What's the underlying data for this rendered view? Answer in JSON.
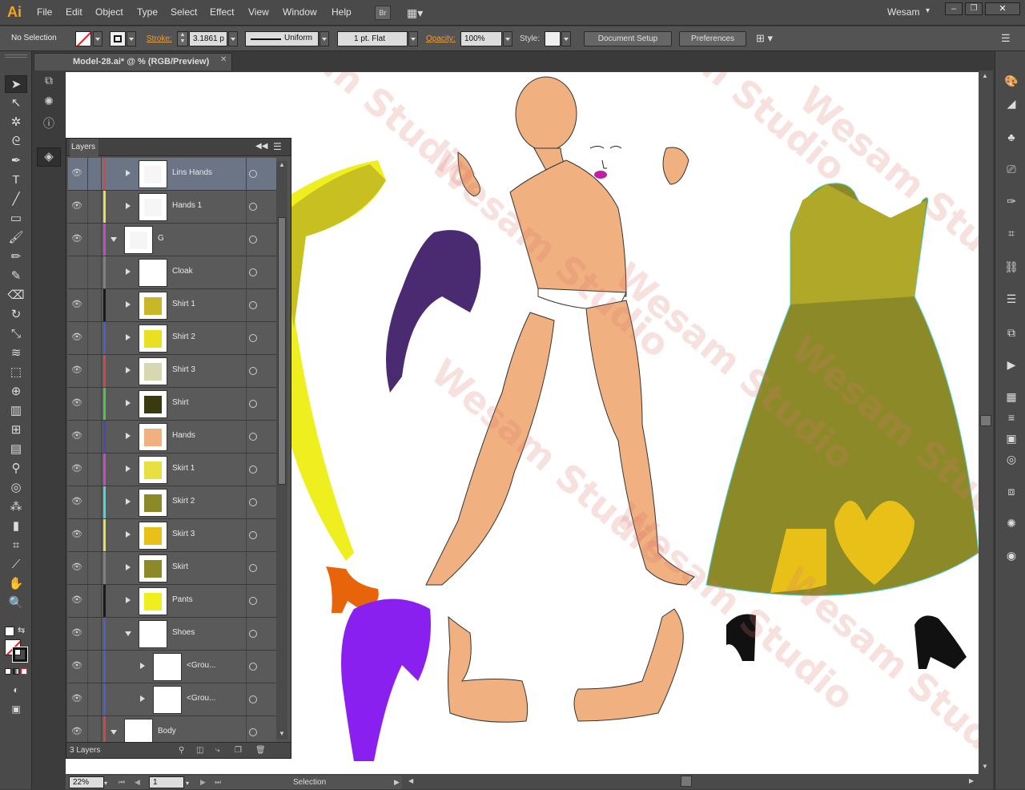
{
  "app": {
    "logo": "Ai",
    "user": "Wesam",
    "br": "Br"
  },
  "menu": [
    "File",
    "Edit",
    "Object",
    "Type",
    "Select",
    "Effect",
    "View",
    "Window",
    "Help"
  ],
  "control": {
    "selection": "No Selection",
    "stroke_label": "Stroke:",
    "stroke_value": "3.1861 p",
    "uniform": "Uniform",
    "brush": "1 pt. Flat",
    "opacity_label": "Opacity:",
    "opacity_value": "100%",
    "style_label": "Style:",
    "doc_setup": "Document Setup",
    "preferences": "Preferences"
  },
  "document": {
    "tab": "Model-28.ai* @ % (RGB/Preview)"
  },
  "layers": {
    "title": "Layers",
    "footer": "3 Layers",
    "rows": [
      {
        "name": "Lins Hands",
        "color": "#d04848",
        "selected": true
      },
      {
        "name": "Hands 1",
        "color": "#e8e048"
      },
      {
        "name": "G",
        "color": "#c848c8"
      },
      {
        "name": "Cloak",
        "color": "#808080"
      },
      {
        "name": "Shirt 1",
        "color": "#1a1a1a"
      },
      {
        "name": "Shirt 2",
        "color": "#4860c8"
      },
      {
        "name": "Shirt 3",
        "color": "#d04848"
      },
      {
        "name": "Shirt",
        "color": "#48c848"
      },
      {
        "name": "Hands",
        "color": "#4848b8"
      },
      {
        "name": "Skirt 1",
        "color": "#c848c8"
      },
      {
        "name": "Skirt 2",
        "color": "#48d8d8"
      },
      {
        "name": "Skirt 3",
        "color": "#e8e048"
      },
      {
        "name": "Skirt",
        "color": "#808080"
      },
      {
        "name": "Pants",
        "color": "#1a1a1a"
      },
      {
        "name": "Shoes",
        "color": "#4860c8"
      },
      {
        "name": "<Grou...",
        "color": "#4860c8"
      },
      {
        "name": "<Grou...",
        "color": "#4860c8"
      },
      {
        "name": "Body",
        "color": "#d04848"
      }
    ]
  },
  "status": {
    "zoom": "22%",
    "page": "1",
    "tool": "Selection"
  },
  "watermark": "Wesam Studio"
}
